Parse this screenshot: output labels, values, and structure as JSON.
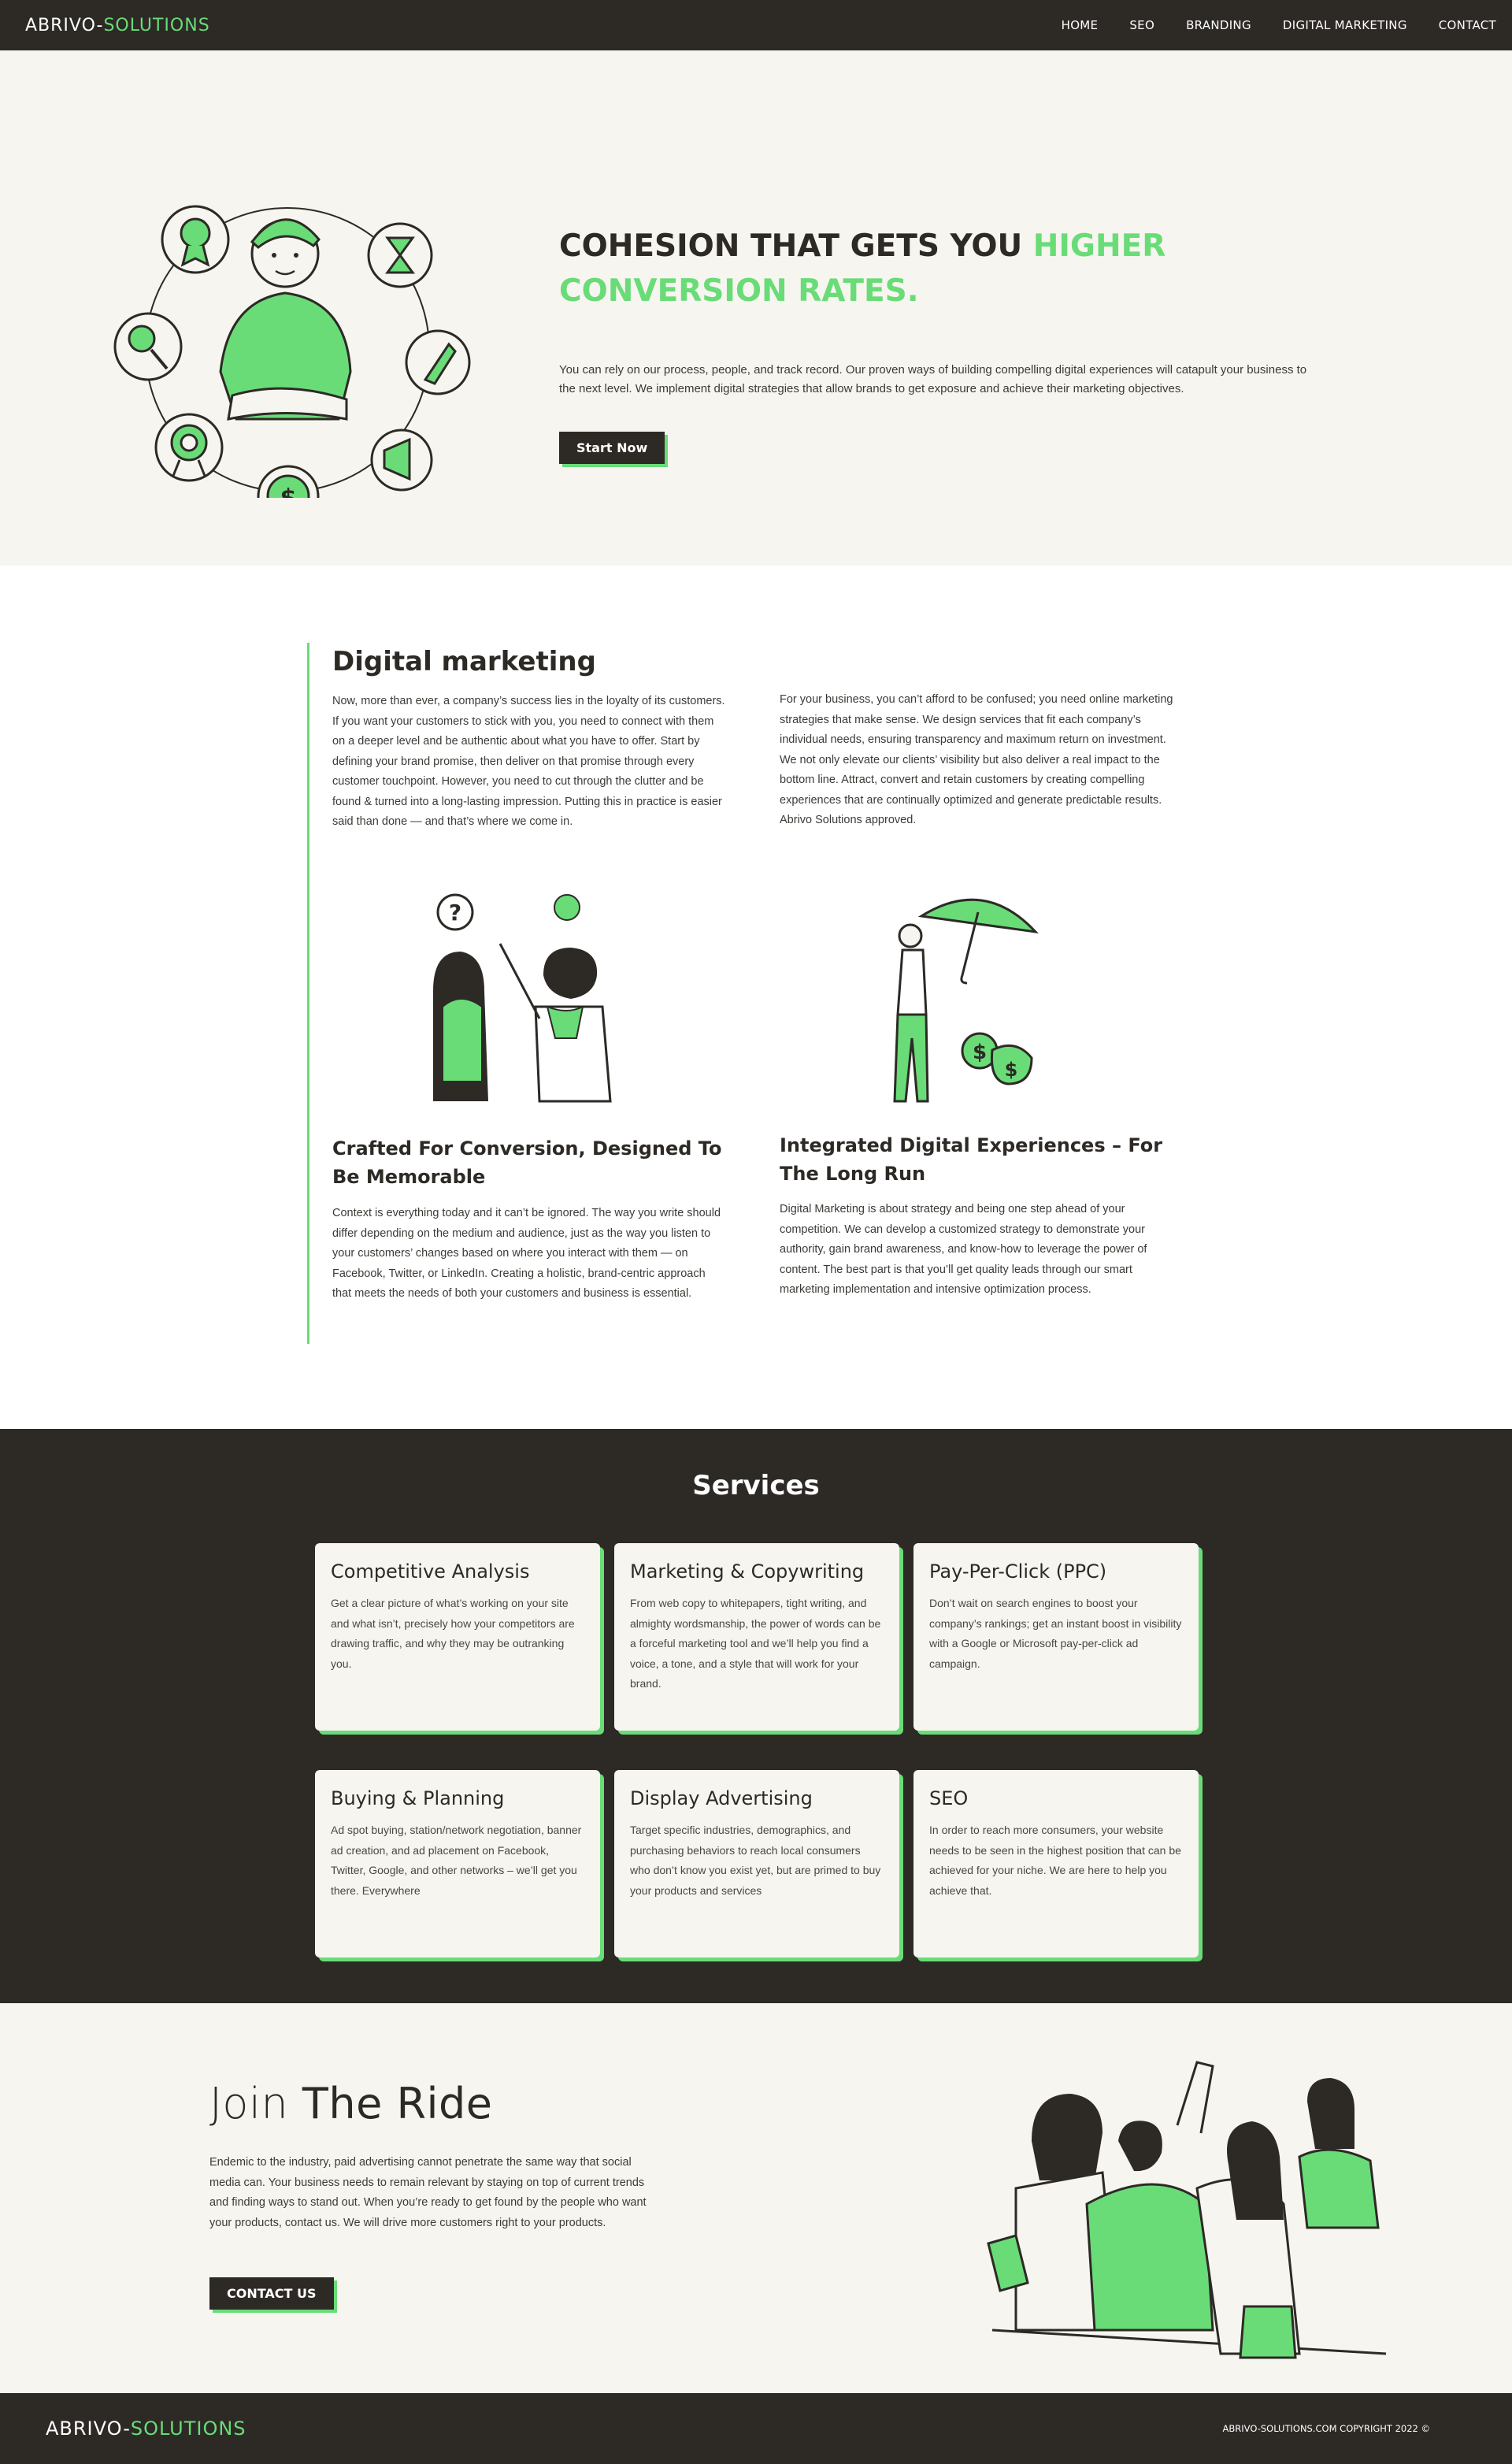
{
  "nav": {
    "brand_a": "ABRIVO-",
    "brand_b": "SOLUTIONS",
    "items": [
      "HOME",
      "SEO",
      "BRANDING",
      "DIGITAL MARKETING",
      "CONTACT"
    ]
  },
  "hero": {
    "title_a": "COHESION THAT GETS YOU ",
    "title_b": "HIGHER CONVERSION RATES.",
    "description": "You can rely on our process, people, and track record. Our proven ways of building compelling digital experiences will catapult your business to the next level. We implement digital strategies that allow brands to get exposure and achieve their marketing objectives.",
    "cta": "Start Now",
    "icons": [
      "person-icon",
      "award-icon",
      "hourglass-icon",
      "rocket-icon",
      "megaphone-icon",
      "dollar-icon",
      "target-icon",
      "magnifier-icon"
    ]
  },
  "digital": {
    "title": "Digital marketing",
    "col1": "Now, more than ever, a company’s success lies in the loyalty of its customers. If you want your customers to stick with you, you need to connect with them on a deeper level and be authentic about what you have to offer. Start by defining your brand promise, then deliver on that promise through every customer touchpoint. However, you need to cut through the clutter and be found & turned into a long-lasting impression. Putting this in practice is easier said than done — and that’s where we come in.",
    "col2": "For your business, you can’t afford to be confused; you need online marketing strategies that make sense. We design services that fit each company’s individual needs, ensuring transparency and maximum return on investment. We not only elevate our clients’ visibility but also deliver a real impact to the bottom line. Attract, convert and retain customers by creating compelling experiences that are continually optimized and generate predictable results. Abrivo Solutions approved.",
    "h3a": "Crafted For Conversion, Designed To Be Memorable",
    "p3a": "Context is everything today and it can’t be ignored. The way you write should differ depending on the medium and audience, just as the way you listen to your customers’ changes based on where you interact with them — on Facebook, Twitter, or LinkedIn. Creating a holistic, brand-centric approach that meets the needs of both your customers and business is essential.",
    "h3b": "Integrated Digital Experiences – For The Long Run",
    "p3b": "Digital Marketing is about strategy and being one step ahead of your competition. We can develop a customized strategy to demonstrate your authority, gain brand awareness, and know-how to leverage the power of content. The best part is that you’ll get quality leads through our smart marketing implementation and intensive optimization process."
  },
  "services": {
    "title": "Services",
    "cards": [
      {
        "title": "Competitive Analysis",
        "text": "Get a clear picture of what’s working on your site and what isn’t, precisely how your competitors are drawing traffic, and why they may be outranking you."
      },
      {
        "title": "Marketing & Copywriting",
        "text": "From web copy to whitepapers, tight writing, and almighty wordsmanship, the power of words can be a forceful marketing tool and we’ll help you find a voice, a tone, and a style that will work for your brand."
      },
      {
        "title": "Pay-Per-Click (PPC)",
        "text": "Don’t wait on search engines to boost your company’s rankings; get an instant boost in visibility with a Google or Microsoft pay-per-click ad campaign."
      },
      {
        "title": "Buying & Planning",
        "text": "Ad spot buying, station/network negotiation, banner ad creation, and ad placement on Facebook, Twitter, Google, and other networks – we’ll get you there. Everywhere"
      },
      {
        "title": "Display Advertising",
        "text": "Target specific industries, demographics, and purchasing behaviors to reach local consumers who don’t know you exist yet, but are primed to buy your products and services"
      },
      {
        "title": "SEO",
        "text": "In order to reach more consumers, your website needs to be seen in the highest position that can be achieved for your niche. We are here to help you achieve that."
      }
    ]
  },
  "join": {
    "title_a": "Join",
    "title_b": " The Ride",
    "text": "Endemic to the industry, paid advertising cannot penetrate the same way that social media can. Your business needs to remain relevant by staying on top of current trends and finding ways to stand out. When you’re ready to get found by the people who want your products, contact us. We will drive more customers right to your products.",
    "cta": "CONTACT US"
  },
  "footer": {
    "brand_a": "ABRIVO-",
    "brand_b": "SOLUTIONS",
    "copyright": "ABRIVO-SOLUTIONS.COM COPYRIGHT 2022 ©"
  },
  "colors": {
    "dark": "#2d2a26",
    "accent": "#69dc78",
    "cream": "#f7f5ef"
  }
}
